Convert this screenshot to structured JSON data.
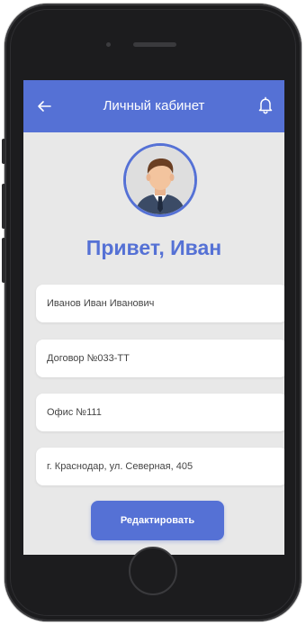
{
  "header": {
    "title": "Личный кабинет",
    "back_icon": "arrow-left-icon",
    "notification_icon": "bell-icon",
    "color": "#5571d5"
  },
  "profile": {
    "avatar_icon": "user-avatar",
    "greeting": "Привет, Иван"
  },
  "fields": {
    "full_name": "Иванов Иван Иванович",
    "contract": "Договор №033-ТТ",
    "office": "Офис №111",
    "address": "г. Краснодар, ул. Северная, 405"
  },
  "actions": {
    "edit_label": "Редактировать"
  },
  "colors": {
    "accent": "#5571d5",
    "screen_bg": "#e8e8e8",
    "field_bg": "#ffffff"
  }
}
